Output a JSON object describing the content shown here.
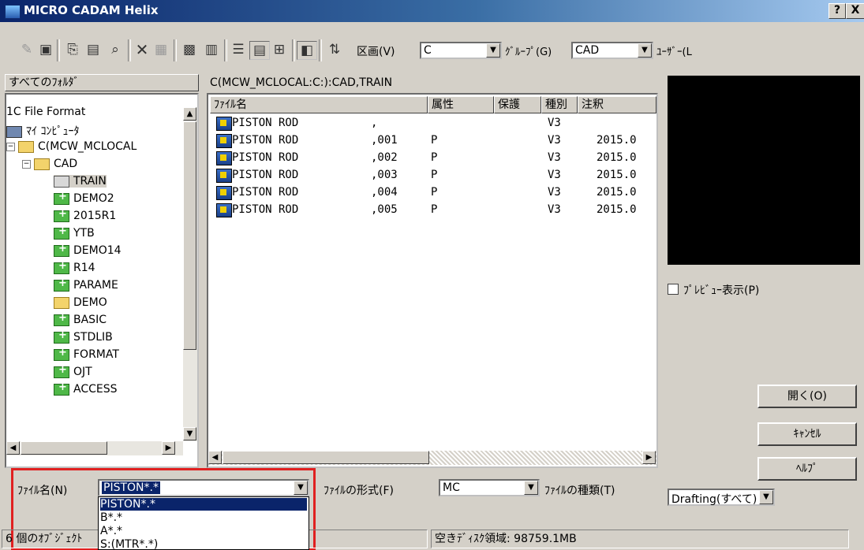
{
  "window": {
    "title": "MICRO CADAM Helix",
    "help_btn": "?",
    "close_btn": "X"
  },
  "toolbar": {
    "kukaku_label": "区画(V)",
    "kukaku_value": "C",
    "group_label": "ｸﾞﾙｰﾌﾟ(G)",
    "group_value": "CAD",
    "user_label": "ﾕｰｻﾞｰ(L"
  },
  "tree": {
    "header": "すべてのﾌｫﾙﾀﾞ",
    "items": [
      {
        "label": "1C File Format"
      },
      {
        "label": "ﾏｲ ｺﾝﾋﾟｭｰﾀ"
      },
      {
        "label": "C(MCW_MCLOCAL"
      },
      {
        "label": "CAD"
      },
      {
        "label": "TRAIN"
      },
      {
        "label": "DEMO2"
      },
      {
        "label": "2015R1"
      },
      {
        "label": "YTB"
      },
      {
        "label": "DEMO14"
      },
      {
        "label": "R14"
      },
      {
        "label": "PARAME"
      },
      {
        "label": "DEMO"
      },
      {
        "label": "BASIC"
      },
      {
        "label": "STDLIB"
      },
      {
        "label": "FORMAT"
      },
      {
        "label": "OJT"
      },
      {
        "label": "ACCESS"
      }
    ]
  },
  "files": {
    "path": "C(MCW_MCLOCAL:C:):CAD,TRAIN",
    "columns": [
      "ﾌｧｲﾙ名",
      "属性",
      "保護",
      "種別",
      "注釈"
    ],
    "rows": [
      {
        "name": "PISTON ROD",
        "suffix": ",",
        "attr": "",
        "kind": "V3",
        "note": ""
      },
      {
        "name": "PISTON ROD",
        "suffix": ",001",
        "attr": "P",
        "kind": "V3",
        "note": "2015.0"
      },
      {
        "name": "PISTON ROD",
        "suffix": ",002",
        "attr": "P",
        "kind": "V3",
        "note": "2015.0"
      },
      {
        "name": "PISTON ROD",
        "suffix": ",003",
        "attr": "P",
        "kind": "V3",
        "note": "2015.0"
      },
      {
        "name": "PISTON ROD",
        "suffix": ",004",
        "attr": "P",
        "kind": "V3",
        "note": "2015.0"
      },
      {
        "name": "PISTON ROD",
        "suffix": ",005",
        "attr": "P",
        "kind": "V3",
        "note": "2015.0"
      }
    ]
  },
  "preview": {
    "checkbox_label": "ﾌﾟﾚﾋﾞｭｰ表示(P)"
  },
  "buttons": {
    "open": "開く(O)",
    "cancel": "ｷｬﾝｾﾙ",
    "help": "ﾍﾙﾌﾟ"
  },
  "bottom": {
    "filename_label": "ﾌｧｲﾙ名(N)",
    "filename_value": "PISTON*.*",
    "format_label": "ﾌｧｲﾙの形式(F)",
    "format_value": "MC",
    "type_label": "ﾌｧｲﾙの種類(T)",
    "type_value": "Drafting(すべて)",
    "dropdown_options": [
      "PISTON*.*",
      "B*.*",
      "A*.*",
      "S:(MTR*.*)"
    ]
  },
  "status": {
    "objects": "6 個のｵﾌﾞｼﾞｪｸﾄ",
    "disk": "空きﾃﾞｨｽｸ領域: 98759.1MB"
  },
  "colors": {
    "highlight": "#0a246a",
    "red_box": "#e02020",
    "title_start": "#0a246a",
    "title_end": "#a6caf0"
  }
}
